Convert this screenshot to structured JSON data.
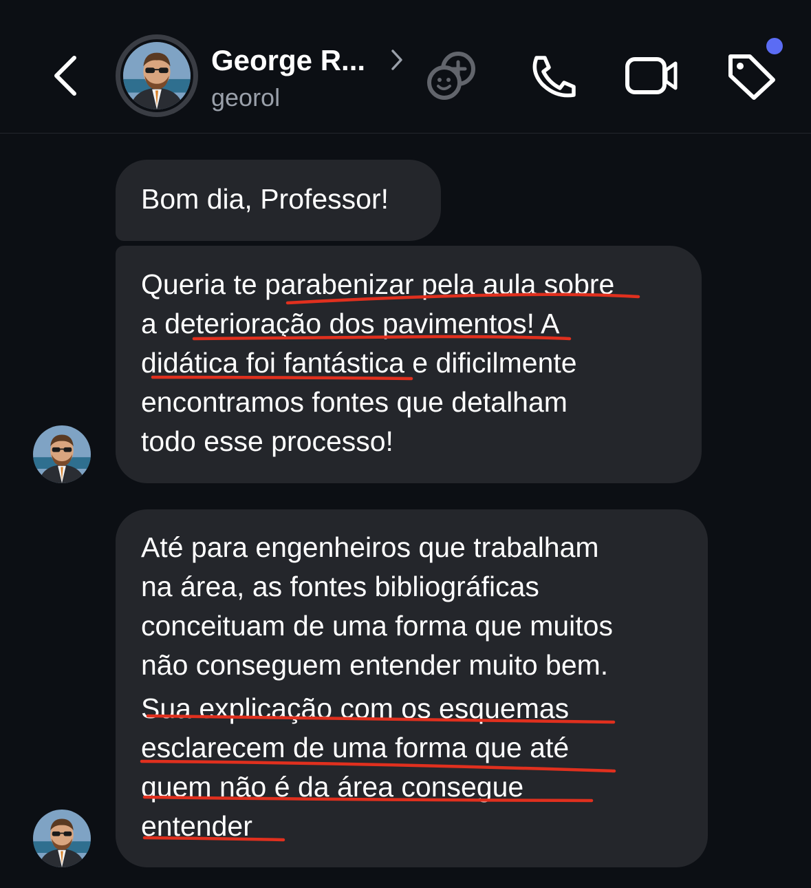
{
  "header": {
    "contact_name": "George R...",
    "username": "georol",
    "unread_indicator_color": "#5b6cf4",
    "icons": [
      "back-icon",
      "chevron-right-icon",
      "effects-icon",
      "phone-icon",
      "video-icon",
      "tag-icon"
    ]
  },
  "messages": [
    {
      "lines": [
        "Bom dia, Professor!"
      ]
    },
    {
      "lines": [
        "Queria te parabenizar pela aula sobre",
        "a deterioração dos pavimentos! A",
        "didática foi fantástica e dificilmente",
        "encontramos fontes que detalham",
        "todo esse processo!"
      ]
    },
    {
      "lines": [
        "Até para engenheiros que trabalham",
        "na área, as fontes bibliográficas",
        "conceituam de uma forma que muitos",
        "não conseguem entender muito bem.",
        "Sua explicação com os esquemas",
        "esclarecem de uma forma que até",
        "quem não é da área consegue",
        "entender"
      ]
    }
  ],
  "colors": {
    "background": "#0c0f14",
    "bubble": "#24262b",
    "annotation_underline": "#e0301e"
  }
}
